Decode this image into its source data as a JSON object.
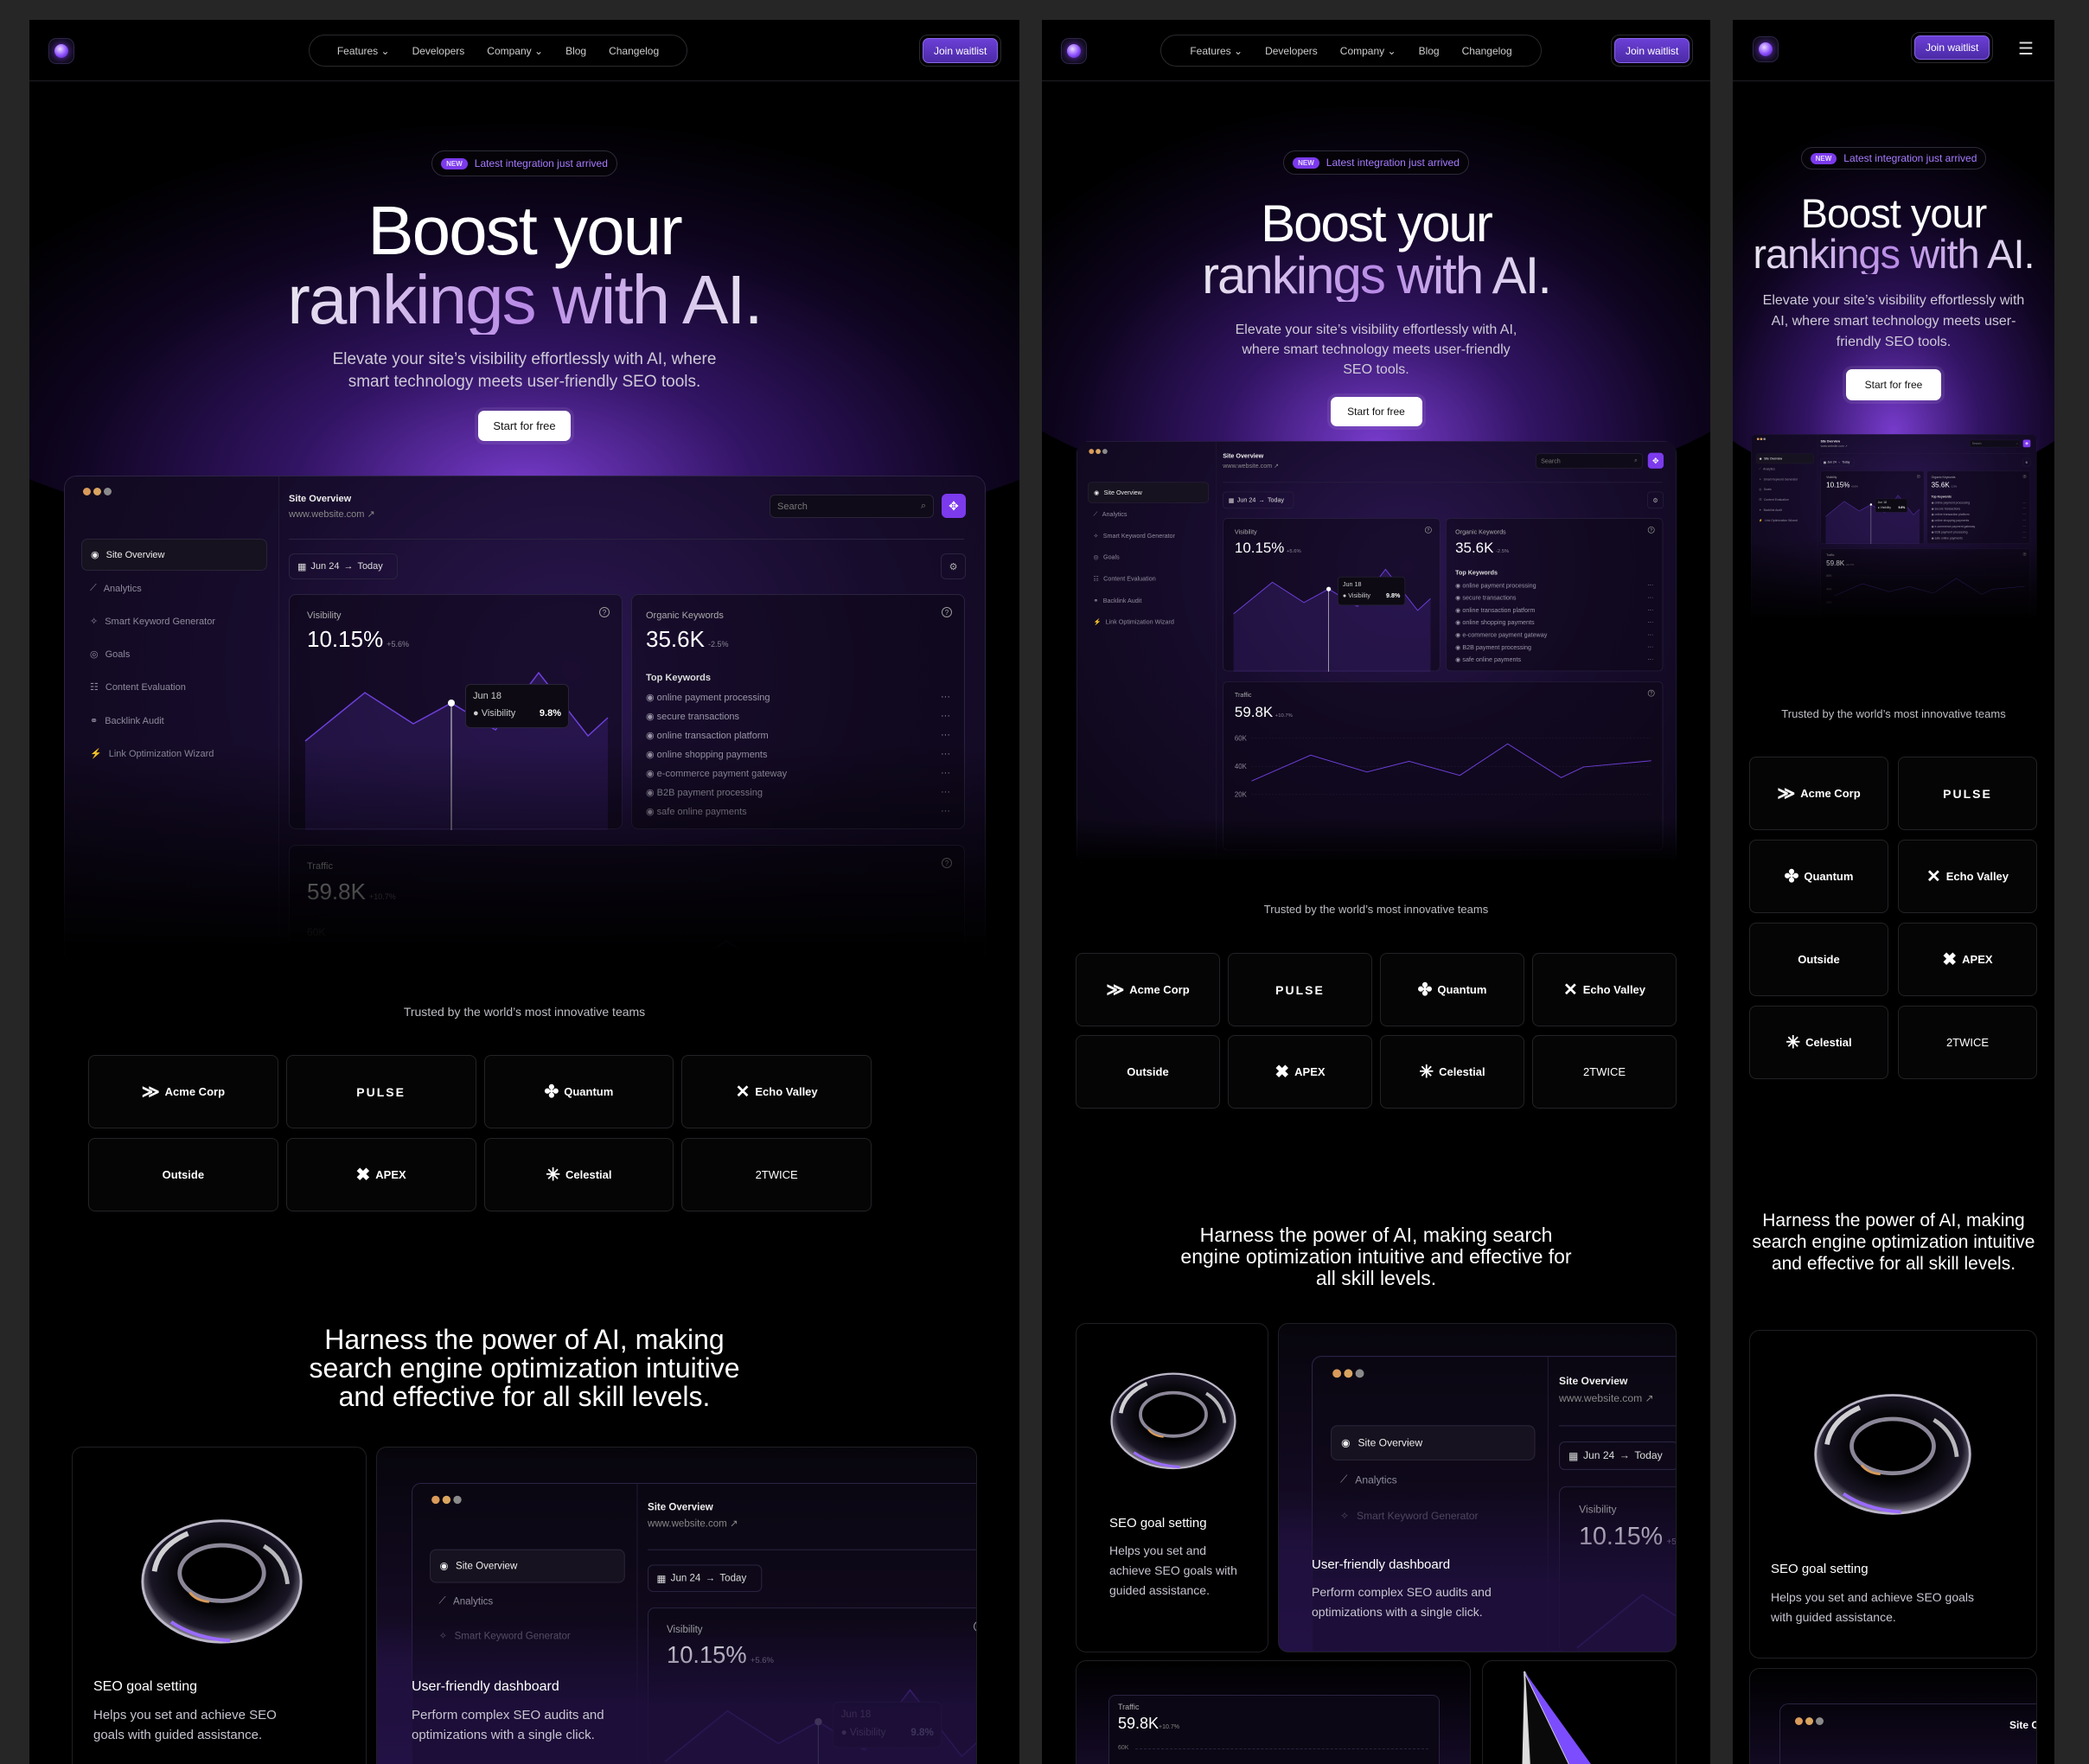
{
  "nav": {
    "items": [
      {
        "label": "Features",
        "dropdown": true
      },
      {
        "label": "Developers",
        "dropdown": false
      },
      {
        "label": "Company",
        "dropdown": true
      },
      {
        "label": "Blog",
        "dropdown": false
      },
      {
        "label": "Changelog",
        "dropdown": false
      }
    ],
    "cta": "Join waitlist",
    "menu_icon": "hamburger-icon"
  },
  "hero": {
    "badge_tag": "NEW",
    "badge_text": "Latest integration just arrived",
    "title_line1": "Boost your",
    "title_line2": "rankings with AI.",
    "subtitle": "Elevate your site’s visibility effortlessly with AI, where smart technology meets user-friendly SEO tools.",
    "cta": "Start for free"
  },
  "dashboard": {
    "title": "Site Overview",
    "url": "www.website.com ↗",
    "search_placeholder": "Search",
    "sidebar": [
      {
        "label": "Site Overview",
        "icon": "eye-icon",
        "active": true
      },
      {
        "label": "Analytics",
        "icon": "chart-icon"
      },
      {
        "label": "Smart Keyword Generator",
        "icon": "sparkle-icon"
      },
      {
        "label": "Goals",
        "icon": "target-icon"
      },
      {
        "label": "Content Evaluation",
        "icon": "list-icon"
      },
      {
        "label": "Backlink Audit",
        "icon": "link-icon"
      },
      {
        "label": "Link Optimization Wizard",
        "icon": "wand-icon"
      }
    ],
    "date_from": "Jun 24",
    "date_to": "Today",
    "visibility": {
      "label": "Visibility",
      "value": "10.15%",
      "delta": "+5.6%",
      "tooltip_date": "Jun 18",
      "tooltip_series": "Visibility",
      "tooltip_value": "9.8%"
    },
    "organic": {
      "label": "Organic Keywords",
      "value": "35.6K",
      "delta": "-2.5%",
      "top_label": "Top Keywords",
      "keywords": [
        "online payment processing",
        "secure transactions",
        "online transaction platform",
        "online shopping payments",
        "e-commerce payment gateway",
        "B2B payment processing",
        "safe online payments"
      ]
    },
    "traffic": {
      "label": "Traffic",
      "value": "59.8K",
      "delta": "+10.7%",
      "ticks": [
        "60K",
        "40K",
        "20K"
      ]
    }
  },
  "trusted": {
    "heading": "Trusted by the world’s most innovative teams",
    "logos": [
      {
        "name": "Acme Corp",
        "icon": "chevrons-icon"
      },
      {
        "name": "PULSE",
        "icon": ""
      },
      {
        "name": "Quantum",
        "icon": "clover-icon"
      },
      {
        "name": "Echo Valley",
        "icon": "x-icon"
      },
      {
        "name": "Outside",
        "icon": ""
      },
      {
        "name": "APEX",
        "icon": "blob-x-icon"
      },
      {
        "name": "Celestial",
        "icon": "asterisk-icon"
      },
      {
        "name": "2TWICE",
        "icon": ""
      }
    ]
  },
  "features": {
    "heading": "Harness the power of AI, making search engine optimization intuitive and effective for all skill levels.",
    "cards": [
      {
        "title": "SEO goal setting",
        "desc": "Helps you set and achieve SEO goals with guided assistance."
      },
      {
        "title": "User-friendly dashboard",
        "desc": "Perform complex SEO audits and optimizations with a single click."
      }
    ]
  },
  "colors": {
    "accent": "#7c3aed",
    "badge_text": "#a77bff",
    "background": "#000000",
    "frame": "#262626"
  }
}
